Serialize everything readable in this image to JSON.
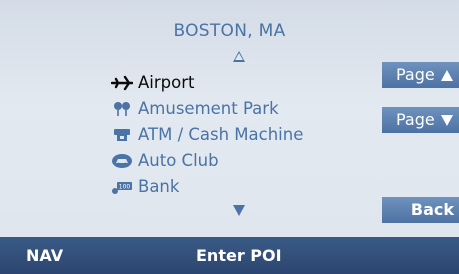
{
  "header": {
    "location": "BOSTON, MA"
  },
  "poi_list": {
    "items": [
      {
        "label": "Airport",
        "icon": "airplane-icon",
        "selected": true
      },
      {
        "label": "Amusement Park",
        "icon": "amusement-park-icon",
        "selected": false
      },
      {
        "label": "ATM / Cash Machine",
        "icon": "atm-icon",
        "selected": false
      },
      {
        "label": "Auto Club",
        "icon": "auto-club-icon",
        "selected": false
      },
      {
        "label": "Bank",
        "icon": "bank-icon",
        "selected": false
      }
    ]
  },
  "softkeys": {
    "page_up": "Page",
    "page_down": "Page",
    "back": "Back"
  },
  "status_bar": {
    "mode": "NAV",
    "title": "Enter POI"
  },
  "colors": {
    "text_blue": "#4a73a6",
    "selected_text": "#0a0a0a",
    "button_blue": "#5a7fb0",
    "status_bar": "#314f7b"
  }
}
